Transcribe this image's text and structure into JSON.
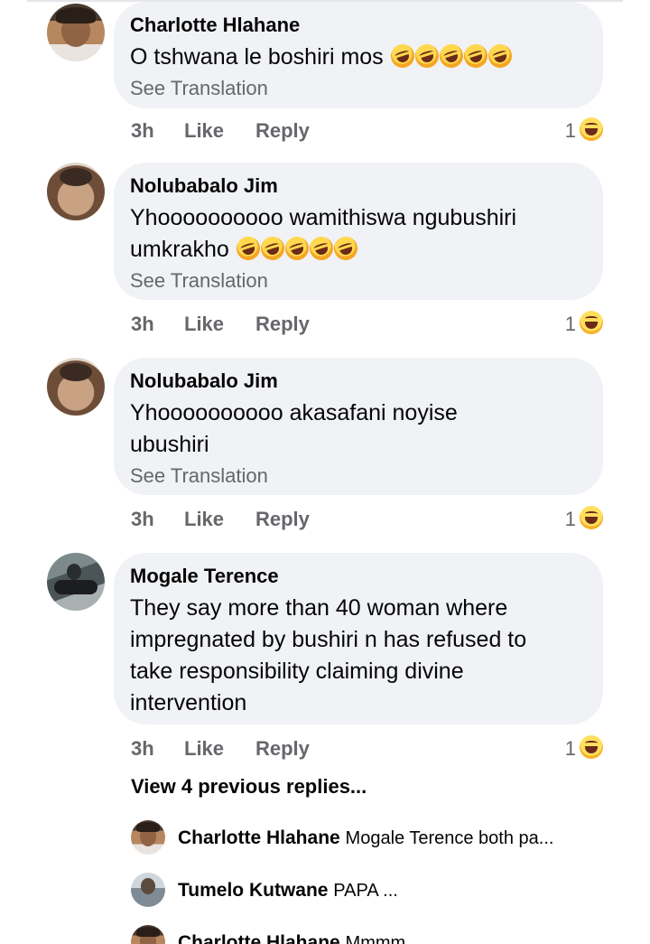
{
  "comments": [
    {
      "author": "Charlotte Hlahane",
      "text": "O tshwana le boshiri mos",
      "emoji_count": 5,
      "translate": "See Translation",
      "time": "3h",
      "like": "Like",
      "reply": "Reply",
      "reactions": "1"
    },
    {
      "author": "Nolubabalo Jim",
      "text_line1": "Yhoooooooooo wamithiswa ngubushiri",
      "text_line2": "umkrakho",
      "emoji_count": 5,
      "translate": "See Translation",
      "time": "3h",
      "like": "Like",
      "reply": "Reply",
      "reactions": "1"
    },
    {
      "author": "Nolubabalo Jim",
      "text_line1": "Yhoooooooooo akasafani noyise",
      "text_line2": "ubushiri",
      "translate": "See Translation",
      "time": "3h",
      "like": "Like",
      "reply": "Reply",
      "reactions": "1"
    },
    {
      "author": "Mogale Terence",
      "text_line1": "They say more than 40 woman where",
      "text_line2": "impregnated by bushiri n has refused to",
      "text_line3": "take responsibility claiming divine",
      "text_line4": "intervention",
      "time": "3h",
      "like": "Like",
      "reply": "Reply",
      "reactions": "1"
    }
  ],
  "view_previous": "View 4 previous replies...",
  "replies": [
    {
      "author": "Charlotte Hlahane",
      "text": "Mogale Terence both pa..."
    },
    {
      "author": "Tumelo Kutwane",
      "text": "PAPA ..."
    },
    {
      "author": "Charlotte Hlahane",
      "text": "Mmmm"
    }
  ],
  "icons": {
    "reaction": "haha-reaction-icon",
    "emoji": "rolling-on-floor-laughing-emoji"
  }
}
